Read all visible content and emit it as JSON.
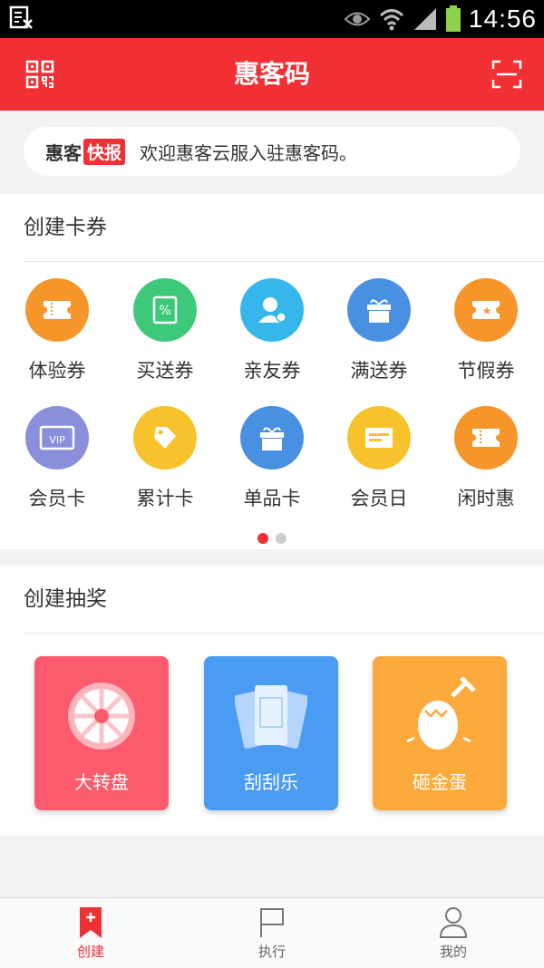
{
  "status_bar": {
    "time": "14:56"
  },
  "app_bar": {
    "title": "惠客码",
    "left_icon": "qr-code-icon",
    "right_icon": "scan-icon",
    "color": "#f03034"
  },
  "news": {
    "brand": "惠客",
    "badge": "快报",
    "message": "欢迎惠客云服入驻惠客码。"
  },
  "coupons": {
    "heading": "创建卡券",
    "items": [
      {
        "label": "体验券",
        "icon": "ticket-icon",
        "color": "#f6952a"
      },
      {
        "label": "买送券",
        "icon": "percent-coupon-icon",
        "color": "#3ec97a"
      },
      {
        "label": "亲友券",
        "icon": "friend-user-icon",
        "color": "#36b6ea"
      },
      {
        "label": "满送券",
        "icon": "gift-box-icon",
        "color": "#4a90e2"
      },
      {
        "label": "节假券",
        "icon": "holiday-star-ticket-icon",
        "color": "#f6952a"
      },
      {
        "label": "会员卡",
        "icon": "vip-card-icon",
        "color": "#8a8fdc"
      },
      {
        "label": "累计卡",
        "icon": "price-tags-icon",
        "color": "#f7c22c"
      },
      {
        "label": "单品卡",
        "icon": "gift-box-icon",
        "color": "#4a90e2"
      },
      {
        "label": "会员日",
        "icon": "card-icon",
        "color": "#f7c22c"
      },
      {
        "label": "闲时惠",
        "icon": "ticket-icon",
        "color": "#f6952a"
      }
    ],
    "page_dots": {
      "total": 2,
      "active": 1
    }
  },
  "lottery": {
    "heading": "创建抽奖",
    "items": [
      {
        "label": "大转盘",
        "icon": "wheel-icon",
        "color": "#fb5b6c"
      },
      {
        "label": "刮刮乐",
        "icon": "scratch-card-icon",
        "color": "#4a9cf3"
      },
      {
        "label": "砸金蛋",
        "icon": "golden-egg-hammer-icon",
        "color": "#fca93d"
      }
    ]
  },
  "tab_bar": {
    "tabs": [
      {
        "label": "创建",
        "icon": "bookmark-plus-icon",
        "active": true
      },
      {
        "label": "执行",
        "icon": "flag-icon",
        "active": false
      },
      {
        "label": "我的",
        "icon": "user-icon",
        "active": false
      }
    ],
    "active_color": "#f03034",
    "inactive_color": "#666666"
  }
}
